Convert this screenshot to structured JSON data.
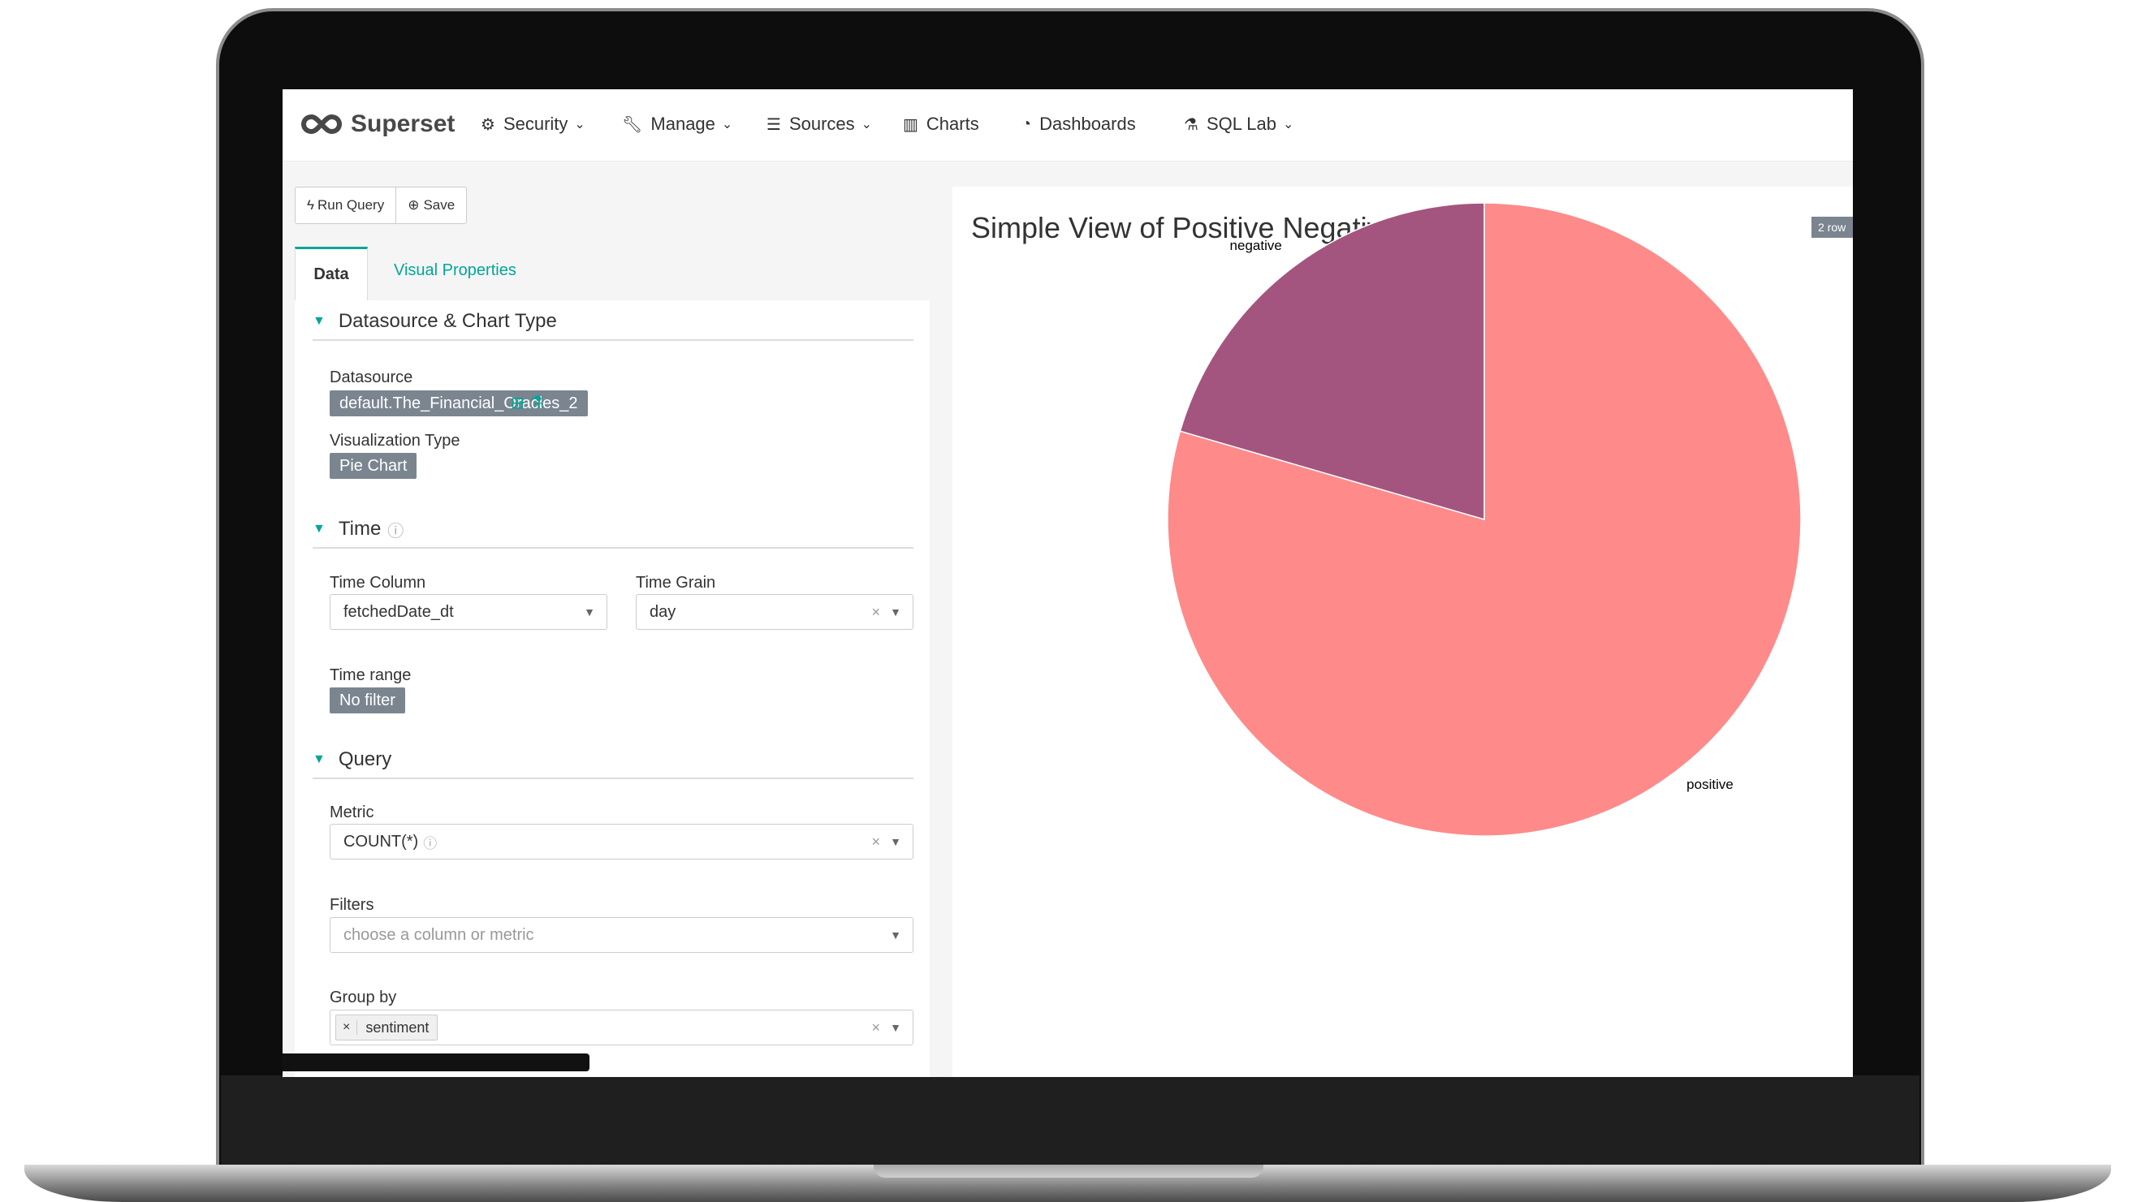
{
  "app": {
    "brand": "Superset"
  },
  "nav": [
    {
      "label": "Security",
      "icon": "gears-icon",
      "dropdown": true
    },
    {
      "label": "Manage",
      "icon": "wrench-icon",
      "dropdown": true
    },
    {
      "label": "Sources",
      "icon": "database-icon",
      "dropdown": true
    },
    {
      "label": "Charts",
      "icon": "bar-chart-icon",
      "dropdown": false
    },
    {
      "label": "Dashboards",
      "icon": "dashboard-icon",
      "dropdown": false
    },
    {
      "label": "SQL Lab",
      "icon": "flask-icon",
      "dropdown": true
    }
  ],
  "toolbar": {
    "run_query": "Run Query",
    "save": "Save"
  },
  "tabs": {
    "data": "Data",
    "visual": "Visual Properties"
  },
  "sections": {
    "datasource": {
      "title": "Datasource & Chart Type",
      "datasource_label": "Datasource",
      "datasource_value": "default.The_Financial_Oracles_2",
      "viz_label": "Visualization Type",
      "viz_value": "Pie Chart"
    },
    "time": {
      "title": "Time",
      "time_column_label": "Time Column",
      "time_column_value": "fetchedDate_dt",
      "time_grain_label": "Time Grain",
      "time_grain_value": "day",
      "time_range_label": "Time range",
      "time_range_value": "No filter"
    },
    "query": {
      "title": "Query",
      "metric_label": "Metric",
      "metric_value": "COUNT(*)",
      "filters_label": "Filters",
      "filters_placeholder": "choose a column or metric",
      "groupby_label": "Group by",
      "groupby_value": "sentiment"
    }
  },
  "chart": {
    "title": "Simple View of Positive Negative",
    "row_badge": "2 row"
  },
  "chart_data": {
    "type": "pie",
    "title": "Simple View of Positive Negative",
    "categories": [
      "positive",
      "negative"
    ],
    "values": [
      79.5,
      20.5
    ],
    "colors": [
      "#ff8a8a",
      "#a3557f"
    ]
  }
}
